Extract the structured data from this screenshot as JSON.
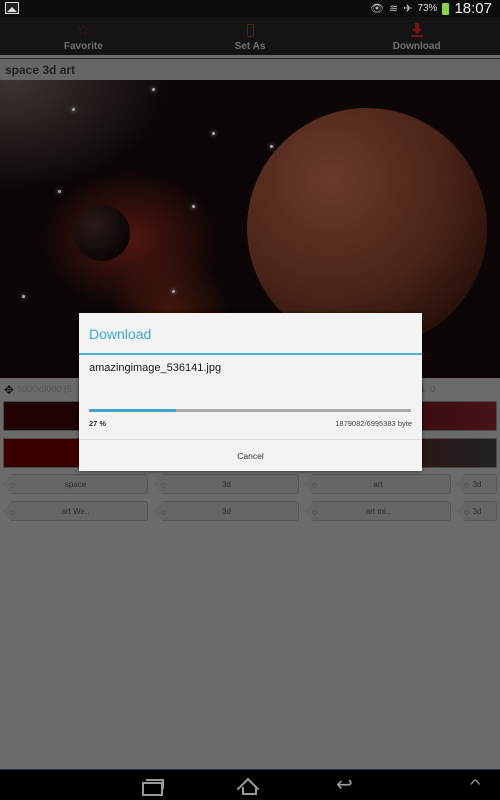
{
  "status_bar": {
    "left_icon": "gallery-notification-icon",
    "icons": [
      "eye-icon",
      "wifi-icon",
      "airplane-icon"
    ],
    "battery_percent": "73%",
    "time": "18:07"
  },
  "action_bar": {
    "actions": [
      {
        "label": "Favorite",
        "icon": "star-icon"
      },
      {
        "label": "Set As",
        "icon": "phone-icon"
      },
      {
        "label": "Download",
        "icon": "download-icon"
      }
    ]
  },
  "page": {
    "title": "space 3d art",
    "resolution": "5000x3000 (6",
    "download_count": "0",
    "colors": {
      "bar1_left": "#1e0204",
      "bar1_right": "#481218",
      "bar2_left": "#3a0000",
      "bar2_right": "#222222"
    }
  },
  "tags": [
    [
      "space",
      "3d",
      "art",
      "3d"
    ],
    [
      "art We..",
      "3d",
      "art mi..",
      "3d"
    ]
  ],
  "dialog": {
    "title": "Download",
    "filename": "amazingimage_536141.jpg",
    "progress_percent": 27,
    "percent_label": "27 %",
    "bytes_label": "1879082/6995383 byte",
    "cancel_label": "Cancel",
    "accent": "#3fa7cf"
  },
  "nav_bar": {
    "buttons": [
      "recent-apps",
      "home",
      "back",
      "menu-up"
    ]
  }
}
